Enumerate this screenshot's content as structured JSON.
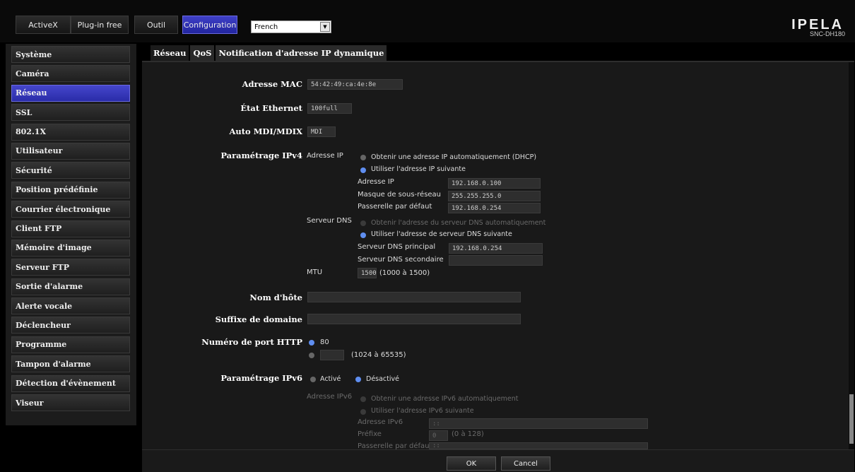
{
  "topbar": {
    "tabs": [
      "ActiveX",
      "Plug-in free",
      "Outil",
      "Configuration"
    ],
    "language": "French",
    "logo": "IPELA",
    "model": "SNC-DH180"
  },
  "sidebar": {
    "items": [
      "Système",
      "Caméra",
      "Réseau",
      "SSL",
      "802.1X",
      "Utilisateur",
      "Sécurité",
      "Position prédéfinie",
      "Courrier électronique",
      "Client FTP",
      "Mémoire d'image",
      "Serveur FTP",
      "Sortie d'alarme",
      "Alerte vocale",
      "Déclencheur",
      "Programme",
      "Tampon d'alarme",
      "Détection d'évènement",
      "Viseur"
    ]
  },
  "tabs": [
    "Réseau",
    "QoS",
    "Notification d'adresse IP dynamique"
  ],
  "form": {
    "mac_label": "Adresse MAC",
    "mac_value": "54:42:49:ca:4e:8e",
    "eth_label": "État Ethernet",
    "eth_value": "100full",
    "mdi_label": "Auto MDI/MDIX",
    "mdi_value": "MDI",
    "ipv4_label": "Paramétrage IPv4",
    "ip_sub_label": "Adresse IP",
    "dhcp_option": "Obtenir une adresse IP automatiquement (DHCP)",
    "static_option": "Utiliser l'adresse IP suivante",
    "ip_addr_label": "Adresse IP",
    "ip_addr_value": "192.168.0.100",
    "mask_label": "Masque de sous-réseau",
    "mask_value": "255.255.255.0",
    "gw_label": "Passerelle par défaut",
    "gw_value": "192.168.0.254",
    "dns_label": "Serveur DNS",
    "dns_auto_option": "Obtenir l'adresse du serveur DNS automatiquement",
    "dns_static_option": "Utiliser l'adresse de serveur DNS suivante",
    "dns1_label": "Serveur DNS principal",
    "dns1_value": "192.168.0.254",
    "dns2_label": "Serveur DNS secondaire",
    "dns2_value": "",
    "mtu_label": "MTU",
    "mtu_value": "1500",
    "mtu_range": "(1000 à 1500)",
    "host_label": "Nom d'hôte",
    "host_value": "",
    "domain_label": "Suffixe de domaine",
    "domain_value": "",
    "http_label": "Numéro de port HTTP",
    "http_default": "80",
    "http_custom_value": "",
    "http_range": "(1024 à 65535)",
    "ipv6_label": "Paramétrage IPv6",
    "ipv6_on": "Activé",
    "ipv6_off": "Désactivé",
    "ipv6_addr_label": "Adresse IPv6",
    "ipv6_auto_option": "Obtenir une adresse IPv6 automatiquement",
    "ipv6_static_option": "Utiliser l'adresse IPv6 suivante",
    "ipv6_field_label": "Adresse IPv6",
    "ipv6_field_value": "::",
    "prefix_label": "Préfixe",
    "prefix_value": "0",
    "prefix_range": "(0 à 128)",
    "ipv6_gw_label": "Passerelle par défaut",
    "ipv6_gw_value": "::"
  },
  "footer": {
    "ok": "OK",
    "cancel": "Cancel"
  }
}
